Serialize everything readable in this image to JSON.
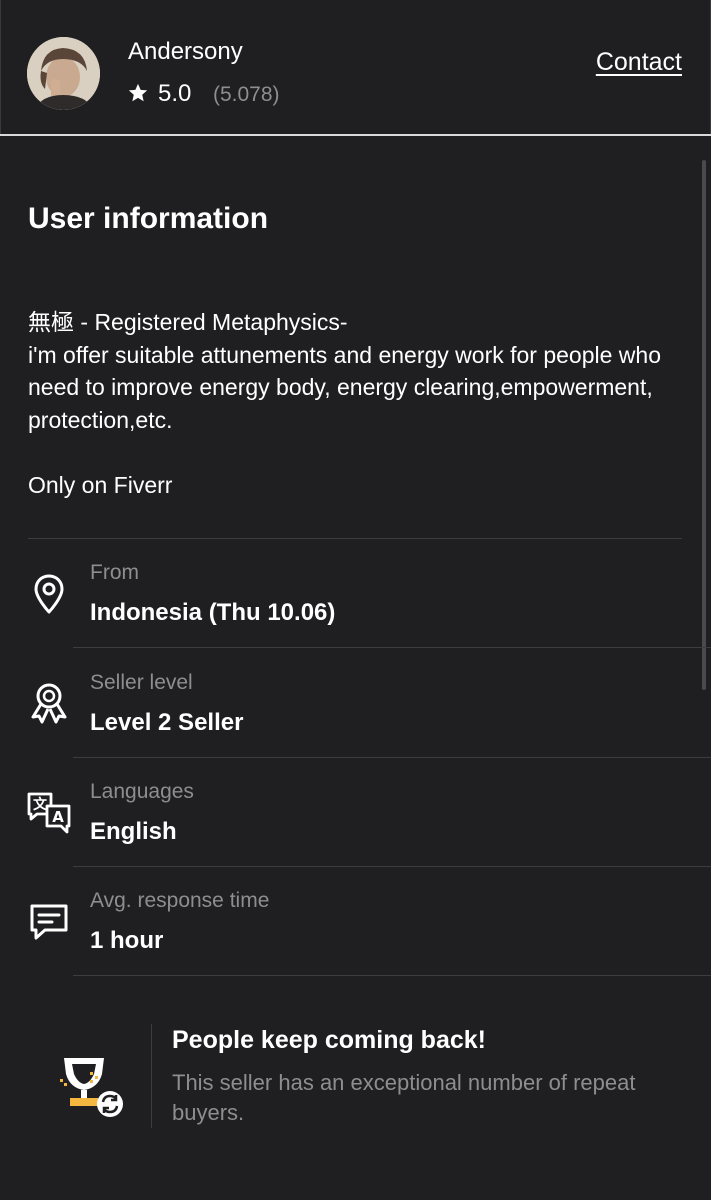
{
  "seller": {
    "name": "Andersony",
    "rating": "5.0",
    "rating_count": "(5.078)",
    "contact_label": "Contact"
  },
  "user_info": {
    "title": "User information",
    "bio": " 無極 - Registered Metaphysics-\n i'm offer suitable attunements and energy work for people who need to improve energy body, energy clearing,empowerment, protection,etc.\n\nOnly on Fiverr",
    "details": [
      {
        "label": "From",
        "value": "Indonesia (Thu 10.06)",
        "icon": "location-pin-icon"
      },
      {
        "label": "Seller level",
        "value": "Level 2 Seller",
        "icon": "award-badge-icon"
      },
      {
        "label": "Languages",
        "value": "English",
        "icon": "translate-icon"
      },
      {
        "label": "Avg. response time",
        "value": "1 hour",
        "icon": "chat-bubble-icon"
      }
    ]
  },
  "promo": {
    "title": "People keep coming back!",
    "text": "This seller has an exceptional number of repeat buyers.",
    "icon": "trophy-repeat-icon"
  },
  "colors": {
    "background": "#1f1f21",
    "text": "#ffffff",
    "muted": "#8d8d92",
    "trophy_gold": "#f4b740"
  }
}
